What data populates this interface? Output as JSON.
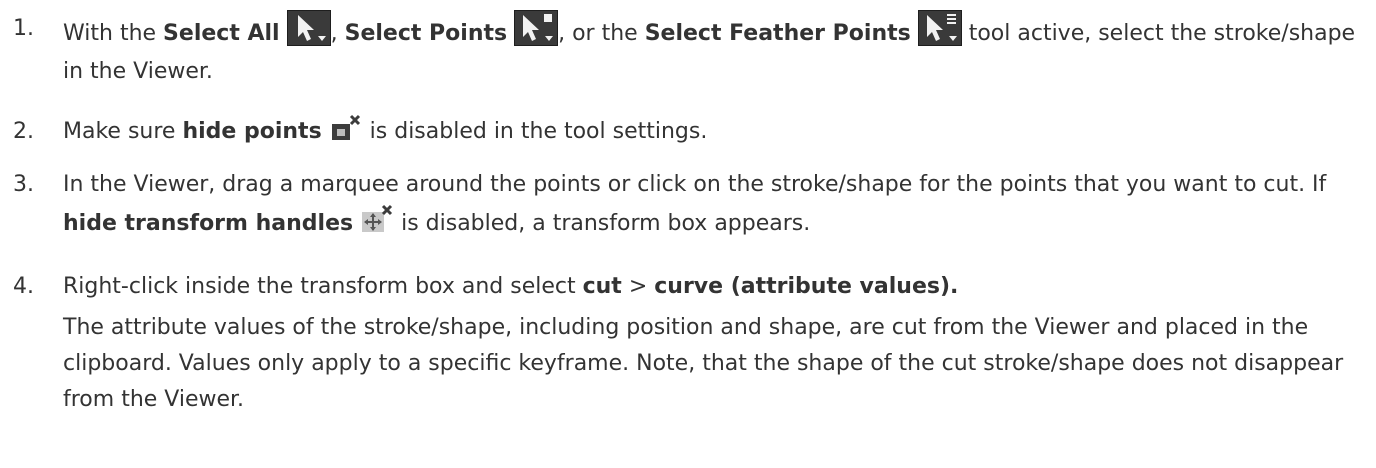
{
  "steps": [
    {
      "number": "1.",
      "t1": "With the ",
      "b1": "Select All",
      "t2": ", ",
      "b2": "Select Points",
      "t3": ", or the ",
      "b3": "Select Feather Points",
      "t4": " tool active, select the stroke/shape in the Viewer.",
      "icons": [
        "select-all-icon",
        "select-points-icon",
        "select-feather-points-icon"
      ]
    },
    {
      "number": "2.",
      "t1": "Make sure ",
      "b1": "hide points",
      "t2": " is disabled in the tool settings.",
      "icons": [
        "hide-points-icon"
      ]
    },
    {
      "number": "3.",
      "t1": "In the Viewer, drag a marquee around the points or click on the stroke/shape for the points that you want to cut. If ",
      "b1": "hide transform handles",
      "t2": " is disabled, a transform box appears.",
      "icons": [
        "hide-transform-handles-icon"
      ]
    },
    {
      "number": "4.",
      "t1": "Right-click inside the transform box and select ",
      "b1": "cut",
      "t2": " > ",
      "b2": "curve (attribute values).",
      "note": "The attribute values of the stroke/shape, including position and shape, are cut from the Viewer and placed in the clipboard. Values only apply to a specific keyframe. Note, that the shape of the cut stroke/shape does not disappear from the Viewer."
    }
  ]
}
